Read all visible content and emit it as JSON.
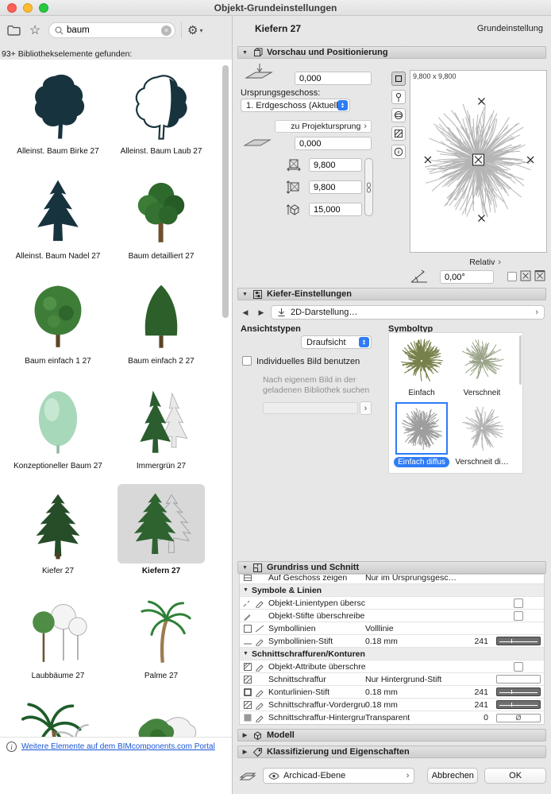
{
  "window": {
    "title": "Objekt-Grundeinstellungen"
  },
  "library": {
    "search": {
      "value": "baum",
      "placeholder": ""
    },
    "results_text": "93+ Bibliothekselemente gefunden:",
    "items": [
      {
        "label": "Alleinst. Baum Birke 27"
      },
      {
        "label": "Alleinst. Baum Laub 27"
      },
      {
        "label": "Alleinst. Baum Nadel 27"
      },
      {
        "label": "Baum detailliert 27"
      },
      {
        "label": "Baum einfach 1 27"
      },
      {
        "label": "Baum einfach 2 27"
      },
      {
        "label": "Konzeptioneller Baum 27"
      },
      {
        "label": "Immergrün 27"
      },
      {
        "label": "Kiefer 27"
      },
      {
        "label": "Kiefern 27",
        "selected": true
      },
      {
        "label": "Laubbäume 27"
      },
      {
        "label": "Palme 27"
      },
      {
        "label": ""
      },
      {
        "label": ""
      }
    ],
    "footer_link": "Weitere Elemente auf dem BIMcomponents.com Portal"
  },
  "header": {
    "object_name": "Kiefern 27",
    "mode_label": "Grundeinstellung"
  },
  "preview": {
    "title": "Vorschau und Positionierung",
    "elevation_value": "0,000",
    "story_label": "Ursprungsgeschoss:",
    "story_value": "1. Erdgeschoss (Aktuell)",
    "to_origin_label": "zu Projektursprung",
    "offset_value": "0,000",
    "dim_width": "9,800",
    "dim_depth": "9,800",
    "dim_height": "15,000",
    "preview_size_label": "9,800 x 9,800",
    "relative_label": "Relativ",
    "angle_value": "0,00°"
  },
  "object_settings": {
    "title": "Kiefer-Einstellungen",
    "page_label": "2D-Darstellung…",
    "view_types_label": "Ansichtstypen",
    "view_type_value": "Draufsicht",
    "custom_image_label": "Individuelles Bild benutzen",
    "custom_image_hint": "Nach eigenem Bild in der geladenen Bibliothek suchen",
    "symbol_type_label": "Symboltyp",
    "symbols": [
      {
        "label": "Einfach"
      },
      {
        "label": "Verschneit"
      },
      {
        "label": "Einfach diffus",
        "selected": true
      },
      {
        "label": "Verschneit di…"
      }
    ]
  },
  "plan_section": {
    "title": "Grundriss und Schnitt",
    "rows": [
      {
        "label": "Auf Geschoss zeigen",
        "value": "Nur im Ursprungsgesc…"
      },
      {
        "label": "Symbole & Linien"
      },
      {
        "label": "Objekt-Linientypen übersc…"
      },
      {
        "label": "Objekt-Stifte überschreiben"
      },
      {
        "label": "Symbollinien",
        "value": "Volllinie"
      },
      {
        "label": "Symbollinien-Stift",
        "value": "0.18 mm",
        "pen": "241"
      },
      {
        "label": "Schnittschraffuren/Konturen"
      },
      {
        "label": "Objekt-Attribute überschrei…"
      },
      {
        "label": "Schnittschraffur",
        "value": "Nur Hintergrund-Stift"
      },
      {
        "label": "Konturlinien-Stift",
        "value": "0.18 mm",
        "pen": "241"
      },
      {
        "label": "Schnittschraffur-Vordergru…",
        "value": "0.18 mm",
        "pen": "241"
      },
      {
        "label": "Schnittschraffur-Hintergrun…",
        "value": "Transparent",
        "pen": "0"
      }
    ]
  },
  "model_section": {
    "title": "Modell"
  },
  "classification_section": {
    "title": "Klassifizierung und Eigenschaften"
  },
  "footer": {
    "layer_value": "Archicad-Ebene",
    "cancel_label": "Abbrechen",
    "ok_label": "OK"
  },
  "colors": {
    "accent": "#2f7cf6",
    "selection_bg": "#d8d8d8",
    "link": "#1a56d6"
  }
}
